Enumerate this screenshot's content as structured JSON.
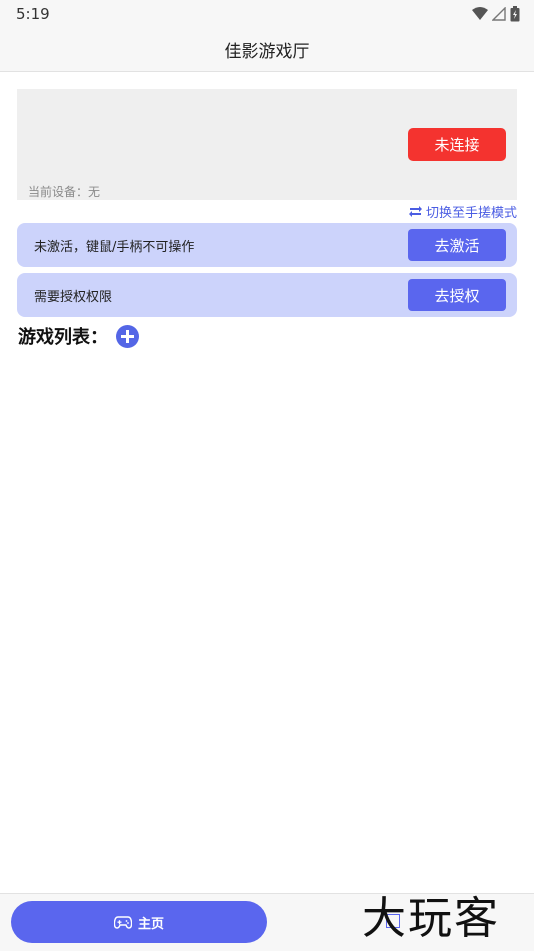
{
  "status_bar": {
    "time": "5:19",
    "icons": [
      "wifi-icon",
      "signal-icon",
      "battery-icon"
    ]
  },
  "header": {
    "title": "佳影游戏厅"
  },
  "device_panel": {
    "connect_label": "未连接",
    "current_device": "当前设备：无"
  },
  "switch_mode": {
    "icon": "swap-icon",
    "label": "切换至手搓模式"
  },
  "banners": [
    {
      "text": "未激活，键鼠/手柄不可操作",
      "button_label": "去激活"
    },
    {
      "text": "需要授权权限",
      "button_label": "去授权"
    }
  ],
  "game_list": {
    "title": "游戏列表：",
    "add_icon": "plus-circle-icon"
  },
  "bottom_nav": {
    "home_icon": "gamepad-icon",
    "home_label": "主页"
  },
  "watermark": "大玩客",
  "colors": {
    "accent": "#5a66ee",
    "disconnected": "#f4332f",
    "banner_bg": "#ccd3fb",
    "panel_bg": "#efefef",
    "link": "#4b5de3"
  }
}
